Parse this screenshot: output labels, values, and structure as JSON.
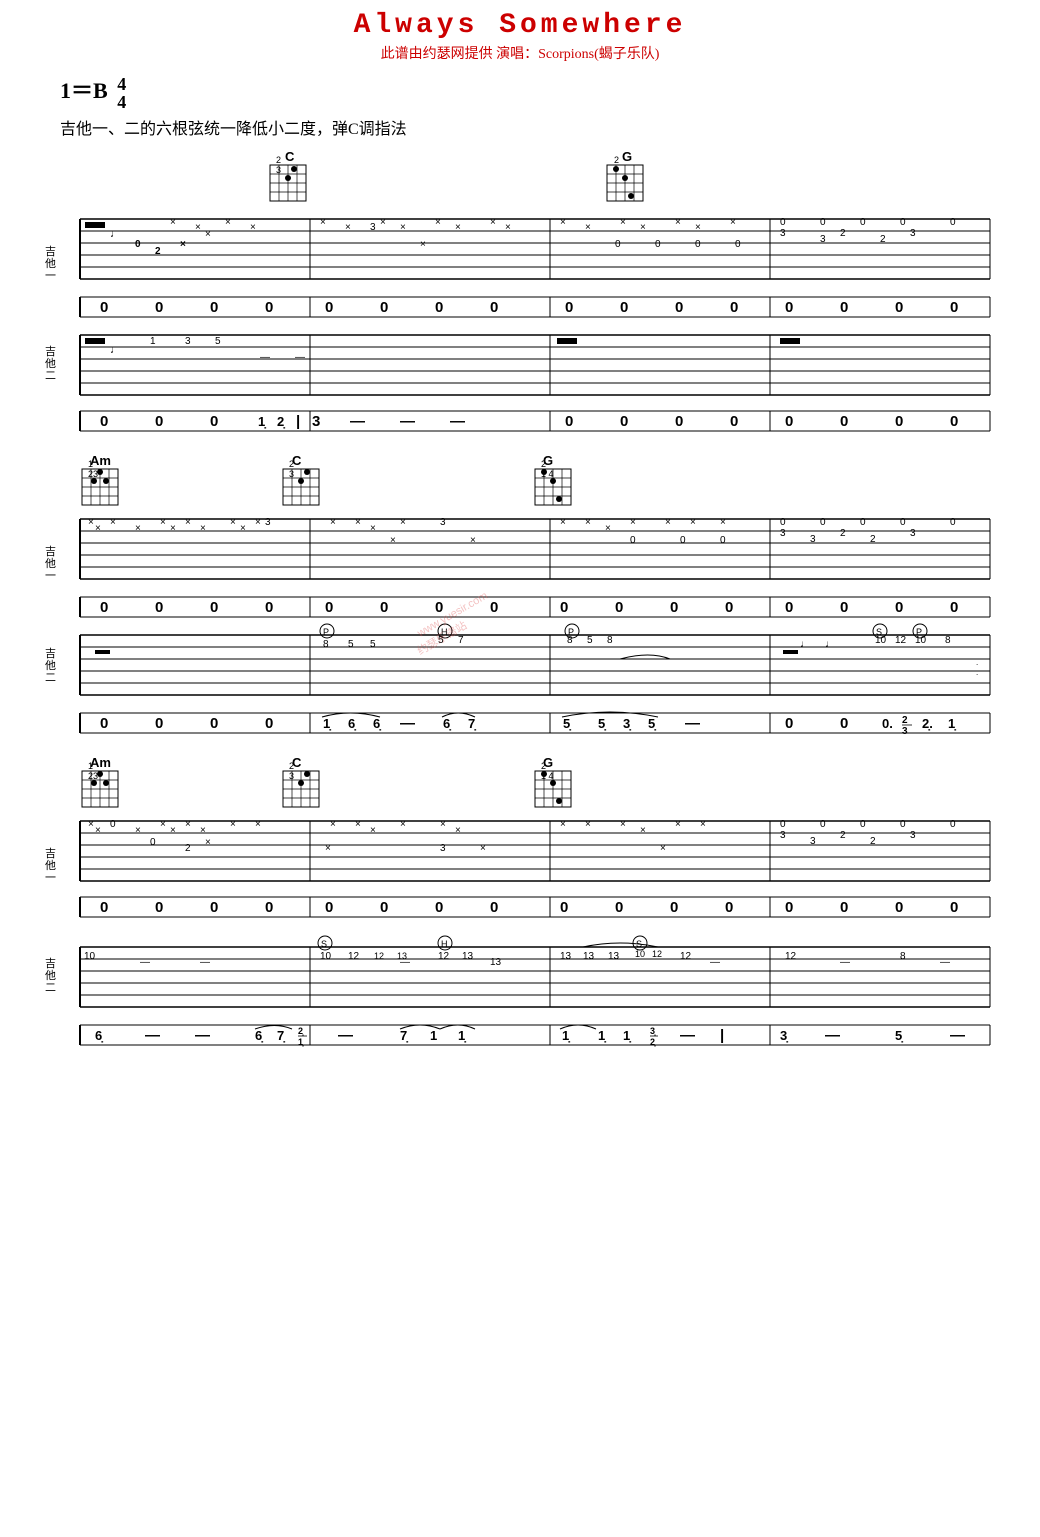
{
  "title": {
    "main": "Always  Somewhere",
    "subtitle": "此谱由约瑟网提供   演唱：Scorpions(蝎子乐队)",
    "key": "1＝B",
    "time_num": "4",
    "time_den": "4"
  },
  "instruction": "吉他一、二的六根弦统一降低小二度，弹C调指法",
  "chords": {
    "section1": [
      {
        "name": "C",
        "position": 250,
        "fingers": "2\n3"
      },
      {
        "name": "G",
        "position": 590,
        "fingers": "2\n1 4"
      }
    ],
    "section2": [
      {
        "name": "Am",
        "position": 40,
        "fingers": "1\n23"
      },
      {
        "name": "C",
        "position": 250,
        "fingers": "2\n3"
      },
      {
        "name": "G",
        "position": 500,
        "fingers": "2\n1 4"
      }
    ],
    "section3": [
      {
        "name": "Am",
        "position": 40,
        "fingers": "1\n23"
      },
      {
        "name": "C",
        "position": 250,
        "fingers": "2\n3"
      },
      {
        "name": "G",
        "position": 500,
        "fingers": "2\n1 4"
      }
    ]
  },
  "watermark": {
    "line1": "www.yuesir.com",
    "line2": "约瑟乐谱站"
  },
  "guitar_labels": {
    "guitar1": "吉他一",
    "guitar2": "吉他二"
  }
}
